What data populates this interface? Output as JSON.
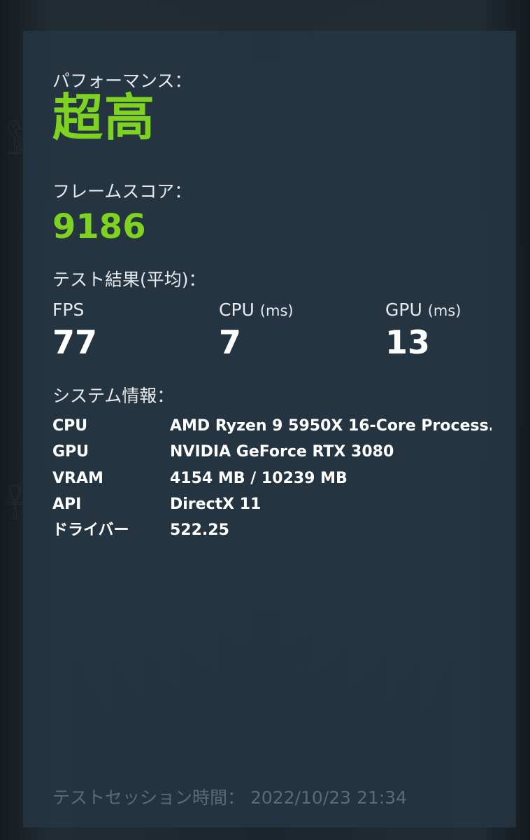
{
  "performance": {
    "label": "パフォーマンス：",
    "quality": "超高"
  },
  "frame_score": {
    "label": "フレームスコア：",
    "value": "9186"
  },
  "test_results": {
    "label": "テスト結果(平均)：",
    "metrics": [
      {
        "name": "FPS",
        "unit": "",
        "value": "77"
      },
      {
        "name": "CPU",
        "unit": "(ms)",
        "value": "7"
      },
      {
        "name": "GPU",
        "unit": "(ms)",
        "value": "13"
      }
    ]
  },
  "system_info": {
    "label": "システム情報：",
    "rows": [
      {
        "key": "CPU",
        "value": "AMD Ryzen 9 5950X 16-Core Process..."
      },
      {
        "key": "GPU",
        "value": "NVIDIA GeForce RTX 3080"
      },
      {
        "key": "VRAM",
        "value": "4154 MB / 10239 MB"
      },
      {
        "key": "API",
        "value": "DirectX 11"
      },
      {
        "key": "ドライバー",
        "value": "522.25"
      }
    ]
  },
  "session": {
    "label": "テストセッション時間：",
    "datetime": "2022/10/23 21:34"
  },
  "colors": {
    "accent": "#7ed321",
    "panel": "#243644",
    "text": "#e6eaed"
  }
}
